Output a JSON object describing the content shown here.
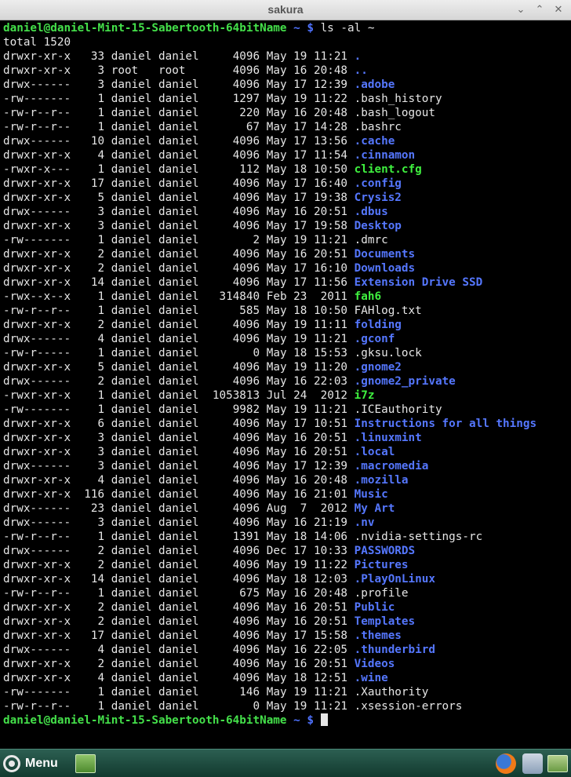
{
  "window": {
    "title": "sakura",
    "minimize_glyph": "⌄",
    "maximize_glyph": "⌃",
    "close_glyph": "✕"
  },
  "terminal": {
    "prompt_user": "daniel@daniel-Mint-15-Sabertooth-64bitName",
    "prompt_path": "~",
    "prompt_symbol": "$",
    "command": "ls -al ~",
    "total": "total 1520",
    "entries": [
      {
        "perms": "drwxr-xr-x",
        "links": "33",
        "owner": "daniel",
        "group": "daniel",
        "size": "4096",
        "date": "May 19 11:21",
        "name": ".",
        "type": "dir"
      },
      {
        "perms": "drwxr-xr-x",
        "links": "3",
        "owner": "root",
        "group": "root",
        "size": "4096",
        "date": "May 16 20:48",
        "name": "..",
        "type": "dir"
      },
      {
        "perms": "drwx------",
        "links": "3",
        "owner": "daniel",
        "group": "daniel",
        "size": "4096",
        "date": "May 17 12:39",
        "name": ".adobe",
        "type": "dir"
      },
      {
        "perms": "-rw-------",
        "links": "1",
        "owner": "daniel",
        "group": "daniel",
        "size": "1297",
        "date": "May 19 11:22",
        "name": ".bash_history",
        "type": "file"
      },
      {
        "perms": "-rw-r--r--",
        "links": "1",
        "owner": "daniel",
        "group": "daniel",
        "size": "220",
        "date": "May 16 20:48",
        "name": ".bash_logout",
        "type": "file"
      },
      {
        "perms": "-rw-r--r--",
        "links": "1",
        "owner": "daniel",
        "group": "daniel",
        "size": "67",
        "date": "May 17 14:28",
        "name": ".bashrc",
        "type": "file"
      },
      {
        "perms": "drwx------",
        "links": "10",
        "owner": "daniel",
        "group": "daniel",
        "size": "4096",
        "date": "May 17 13:56",
        "name": ".cache",
        "type": "dir"
      },
      {
        "perms": "drwxr-xr-x",
        "links": "4",
        "owner": "daniel",
        "group": "daniel",
        "size": "4096",
        "date": "May 17 11:54",
        "name": ".cinnamon",
        "type": "dir"
      },
      {
        "perms": "-rwxr-x---",
        "links": "1",
        "owner": "daniel",
        "group": "daniel",
        "size": "112",
        "date": "May 18 10:50",
        "name": "client.cfg",
        "type": "exec"
      },
      {
        "perms": "drwxr-xr-x",
        "links": "17",
        "owner": "daniel",
        "group": "daniel",
        "size": "4096",
        "date": "May 17 16:40",
        "name": ".config",
        "type": "dir"
      },
      {
        "perms": "drwxr-xr-x",
        "links": "5",
        "owner": "daniel",
        "group": "daniel",
        "size": "4096",
        "date": "May 17 19:38",
        "name": "Crysis2",
        "type": "dir"
      },
      {
        "perms": "drwx------",
        "links": "3",
        "owner": "daniel",
        "group": "daniel",
        "size": "4096",
        "date": "May 16 20:51",
        "name": ".dbus",
        "type": "dir"
      },
      {
        "perms": "drwxr-xr-x",
        "links": "3",
        "owner": "daniel",
        "group": "daniel",
        "size": "4096",
        "date": "May 17 19:58",
        "name": "Desktop",
        "type": "dir"
      },
      {
        "perms": "-rw-------",
        "links": "1",
        "owner": "daniel",
        "group": "daniel",
        "size": "2",
        "date": "May 19 11:21",
        "name": ".dmrc",
        "type": "file"
      },
      {
        "perms": "drwxr-xr-x",
        "links": "2",
        "owner": "daniel",
        "group": "daniel",
        "size": "4096",
        "date": "May 16 20:51",
        "name": "Documents",
        "type": "dir"
      },
      {
        "perms": "drwxr-xr-x",
        "links": "2",
        "owner": "daniel",
        "group": "daniel",
        "size": "4096",
        "date": "May 17 16:10",
        "name": "Downloads",
        "type": "dir"
      },
      {
        "perms": "drwxr-xr-x",
        "links": "14",
        "owner": "daniel",
        "group": "daniel",
        "size": "4096",
        "date": "May 17 11:56",
        "name": "Extension Drive SSD",
        "type": "dir"
      },
      {
        "perms": "-rwx--x--x",
        "links": "1",
        "owner": "daniel",
        "group": "daniel",
        "size": "314840",
        "date": "Feb 23  2011",
        "name": "fah6",
        "type": "exec"
      },
      {
        "perms": "-rw-r--r--",
        "links": "1",
        "owner": "daniel",
        "group": "daniel",
        "size": "585",
        "date": "May 18 10:50",
        "name": "FAHlog.txt",
        "type": "file"
      },
      {
        "perms": "drwxr-xr-x",
        "links": "2",
        "owner": "daniel",
        "group": "daniel",
        "size": "4096",
        "date": "May 19 11:11",
        "name": "folding",
        "type": "dir"
      },
      {
        "perms": "drwx------",
        "links": "4",
        "owner": "daniel",
        "group": "daniel",
        "size": "4096",
        "date": "May 19 11:21",
        "name": ".gconf",
        "type": "dir"
      },
      {
        "perms": "-rw-r-----",
        "links": "1",
        "owner": "daniel",
        "group": "daniel",
        "size": "0",
        "date": "May 18 15:53",
        "name": ".gksu.lock",
        "type": "file"
      },
      {
        "perms": "drwxr-xr-x",
        "links": "5",
        "owner": "daniel",
        "group": "daniel",
        "size": "4096",
        "date": "May 19 11:20",
        "name": ".gnome2",
        "type": "dir"
      },
      {
        "perms": "drwx------",
        "links": "2",
        "owner": "daniel",
        "group": "daniel",
        "size": "4096",
        "date": "May 16 22:03",
        "name": ".gnome2_private",
        "type": "dir"
      },
      {
        "perms": "-rwxr-xr-x",
        "links": "1",
        "owner": "daniel",
        "group": "daniel",
        "size": "1053813",
        "date": "Jul 24  2012",
        "name": "i7z",
        "type": "exec"
      },
      {
        "perms": "-rw-------",
        "links": "1",
        "owner": "daniel",
        "group": "daniel",
        "size": "9982",
        "date": "May 19 11:21",
        "name": ".ICEauthority",
        "type": "file"
      },
      {
        "perms": "drwxr-xr-x",
        "links": "6",
        "owner": "daniel",
        "group": "daniel",
        "size": "4096",
        "date": "May 17 10:51",
        "name": "Instructions for all things",
        "type": "dir"
      },
      {
        "perms": "drwxr-xr-x",
        "links": "3",
        "owner": "daniel",
        "group": "daniel",
        "size": "4096",
        "date": "May 16 20:51",
        "name": ".linuxmint",
        "type": "dir"
      },
      {
        "perms": "drwxr-xr-x",
        "links": "3",
        "owner": "daniel",
        "group": "daniel",
        "size": "4096",
        "date": "May 16 20:51",
        "name": ".local",
        "type": "dir"
      },
      {
        "perms": "drwx------",
        "links": "3",
        "owner": "daniel",
        "group": "daniel",
        "size": "4096",
        "date": "May 17 12:39",
        "name": ".macromedia",
        "type": "dir"
      },
      {
        "perms": "drwxr-xr-x",
        "links": "4",
        "owner": "daniel",
        "group": "daniel",
        "size": "4096",
        "date": "May 16 20:48",
        "name": ".mozilla",
        "type": "dir"
      },
      {
        "perms": "drwxr-xr-x",
        "links": "116",
        "owner": "daniel",
        "group": "daniel",
        "size": "4096",
        "date": "May 16 21:01",
        "name": "Music",
        "type": "dir"
      },
      {
        "perms": "drwx------",
        "links": "23",
        "owner": "daniel",
        "group": "daniel",
        "size": "4096",
        "date": "Aug  7  2012",
        "name": "My Art",
        "type": "dir"
      },
      {
        "perms": "drwx------",
        "links": "3",
        "owner": "daniel",
        "group": "daniel",
        "size": "4096",
        "date": "May 16 21:19",
        "name": ".nv",
        "type": "dir"
      },
      {
        "perms": "-rw-r--r--",
        "links": "1",
        "owner": "daniel",
        "group": "daniel",
        "size": "1391",
        "date": "May 18 14:06",
        "name": ".nvidia-settings-rc",
        "type": "file"
      },
      {
        "perms": "drwx------",
        "links": "2",
        "owner": "daniel",
        "group": "daniel",
        "size": "4096",
        "date": "Dec 17 10:33",
        "name": "PASSWORDS",
        "type": "dir"
      },
      {
        "perms": "drwxr-xr-x",
        "links": "2",
        "owner": "daniel",
        "group": "daniel",
        "size": "4096",
        "date": "May 19 11:22",
        "name": "Pictures",
        "type": "dir"
      },
      {
        "perms": "drwxr-xr-x",
        "links": "14",
        "owner": "daniel",
        "group": "daniel",
        "size": "4096",
        "date": "May 18 12:03",
        "name": ".PlayOnLinux",
        "type": "dir"
      },
      {
        "perms": "-rw-r--r--",
        "links": "1",
        "owner": "daniel",
        "group": "daniel",
        "size": "675",
        "date": "May 16 20:48",
        "name": ".profile",
        "type": "file"
      },
      {
        "perms": "drwxr-xr-x",
        "links": "2",
        "owner": "daniel",
        "group": "daniel",
        "size": "4096",
        "date": "May 16 20:51",
        "name": "Public",
        "type": "dir"
      },
      {
        "perms": "drwxr-xr-x",
        "links": "2",
        "owner": "daniel",
        "group": "daniel",
        "size": "4096",
        "date": "May 16 20:51",
        "name": "Templates",
        "type": "dir"
      },
      {
        "perms": "drwxr-xr-x",
        "links": "17",
        "owner": "daniel",
        "group": "daniel",
        "size": "4096",
        "date": "May 17 15:58",
        "name": ".themes",
        "type": "dir"
      },
      {
        "perms": "drwx------",
        "links": "4",
        "owner": "daniel",
        "group": "daniel",
        "size": "4096",
        "date": "May 16 22:05",
        "name": ".thunderbird",
        "type": "dir"
      },
      {
        "perms": "drwxr-xr-x",
        "links": "2",
        "owner": "daniel",
        "group": "daniel",
        "size": "4096",
        "date": "May 16 20:51",
        "name": "Videos",
        "type": "dir"
      },
      {
        "perms": "drwxr-xr-x",
        "links": "4",
        "owner": "daniel",
        "group": "daniel",
        "size": "4096",
        "date": "May 18 12:51",
        "name": ".wine",
        "type": "dir"
      },
      {
        "perms": "-rw-------",
        "links": "1",
        "owner": "daniel",
        "group": "daniel",
        "size": "146",
        "date": "May 19 11:21",
        "name": ".Xauthority",
        "type": "file"
      },
      {
        "perms": "-rw-r--r--",
        "links": "1",
        "owner": "daniel",
        "group": "daniel",
        "size": "0",
        "date": "May 19 11:21",
        "name": ".xsession-errors",
        "type": "file"
      }
    ]
  },
  "taskbar": {
    "menu_label": "Menu",
    "menu_icon": "gear-icon",
    "launchers": [
      "show-desktop-icon",
      "firefox-icon",
      "thunderbird-icon",
      "files-icon"
    ]
  },
  "colors": {
    "prompt": "#44e04a",
    "directory": "#5577ff",
    "executable": "#3ff03f",
    "text": "#e6e6e6",
    "background": "#000000"
  }
}
